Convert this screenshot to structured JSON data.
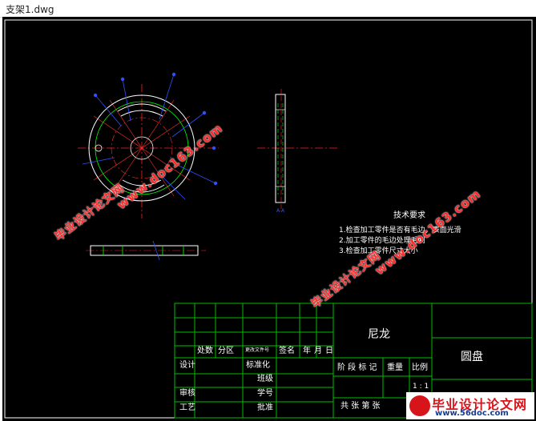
{
  "window": {
    "title": "支架1.dwg"
  },
  "notes": {
    "title": "技术要求",
    "items": [
      "1.检查加工零件是否有毛边，表面光滑",
      "2.加工零件的毛边处理毛刺",
      "3.检查加工零件尺寸大小"
    ]
  },
  "title_block": {
    "material": "尼龙",
    "part_name": "圆盘",
    "row_labels_top": [
      "处数",
      "分区",
      "更改文件号",
      "签名",
      "年",
      "月",
      "日"
    ],
    "left_labels": [
      "设计",
      "审核",
      "工艺"
    ],
    "mid_labels": [
      "标准化",
      "班级",
      "学号",
      "批准"
    ],
    "stage_labels": [
      "阶 段 标 记",
      "重量",
      "比例"
    ],
    "scale": "1 : 1",
    "sheet": "共    张  第    张",
    "view_tag": "A-A"
  },
  "watermarks": [
    {
      "text": "www.doc163.com"
    },
    {
      "text": "毕业设计论文网"
    },
    {
      "text": "www.doc163.com"
    },
    {
      "text": "毕业设计论文网"
    }
  ],
  "logo": {
    "main": "毕业设计论文网",
    "sub": "www.56doc.com"
  },
  "colors": {
    "background": "#000000",
    "lines": "#00ff00",
    "center": "#ff0000",
    "dims": "#0000ff",
    "watermark": "#ff2a2a"
  }
}
